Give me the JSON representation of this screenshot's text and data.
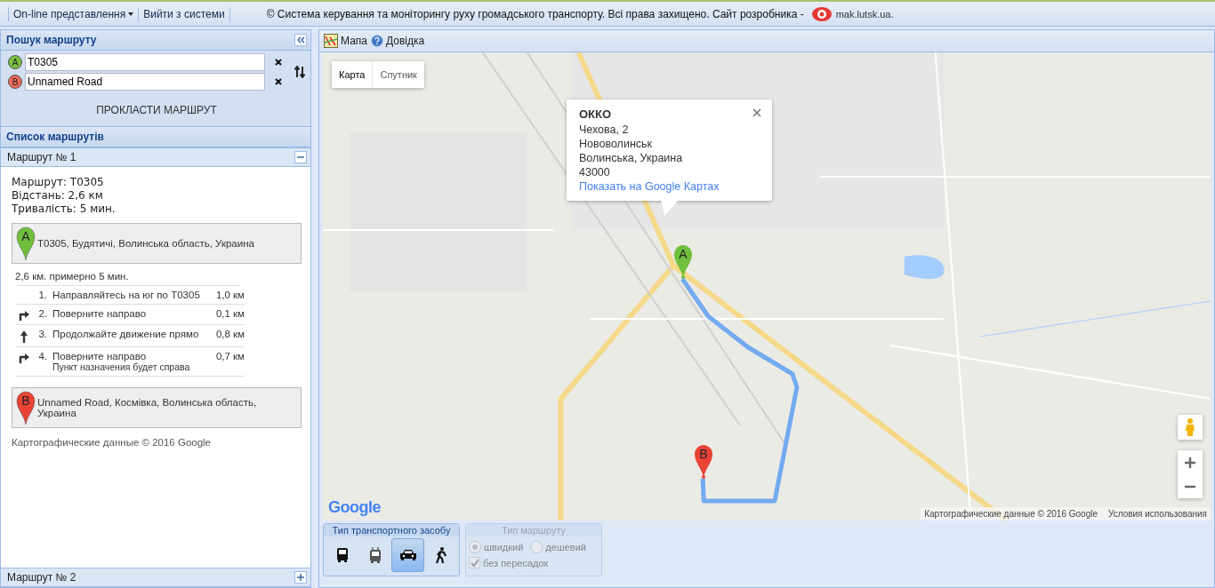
{
  "top_bar": {
    "menu": [
      {
        "label": "On-line представлення",
        "dropdown": true
      },
      {
        "label": "Вийти з системи",
        "dropdown": false
      }
    ],
    "copyright": "© Система керування та моніторингу руху громадського транспорту. Всі права захищено. Сайт розробника -",
    "developer_link": "mak.lutsk.ua."
  },
  "route_search": {
    "title": "Пошук маршруту",
    "from": {
      "letter": "A",
      "value": "T0305"
    },
    "to": {
      "letter": "B",
      "value": "Unnamed Road"
    },
    "build_button": "ПРОКЛАСТИ МАРШРУТ"
  },
  "route_list": {
    "title": "Список маршрутів",
    "routes": [
      {
        "title": "Маршрут № 1",
        "expanded": true,
        "details": {
          "summary": [
            "Маршрут: T0305",
            "Відстань: 2,6 км",
            "Тривалість: 5 мин."
          ],
          "start": {
            "letter": "A",
            "address": "T0305, Будятичі, Волинська область, Украина"
          },
          "overview": "2,6 км. примерно 5 мин.",
          "steps": [
            {
              "kind": "none",
              "number": "1.",
              "instruction": "Направляйтесь на юг по T0305",
              "distance": "1,0 км"
            },
            {
              "kind": "right",
              "number": "2.",
              "instruction": "Поверните направо",
              "distance": "0,1 км"
            },
            {
              "kind": "straight",
              "number": "3.",
              "instruction": "Продолжайте движение прямо",
              "distance": "0,8 км"
            },
            {
              "kind": "right",
              "number": "4.",
              "instruction": "Поверните направо",
              "note": "Пункт назначения будет справа",
              "distance": "0,7 км"
            }
          ],
          "end": {
            "letter": "B",
            "address": "Unnamed Road, Космівка, Волинська область, Украина"
          },
          "copyright": "Картографические данные © 2016 Google"
        }
      },
      {
        "title": "Маршрут № 2",
        "expanded": false
      }
    ]
  },
  "map_toolbar": [
    {
      "label": "Мапа"
    },
    {
      "label": "Довідка"
    }
  ],
  "map": {
    "map_type": [
      {
        "label": "Карта",
        "selected": true
      },
      {
        "label": "Спутник",
        "selected": false
      }
    ],
    "info_window": {
      "title": "ОККО",
      "lines": [
        "Чехова, 2",
        "Нововолинськ",
        "Волинська, Украина",
        "43000"
      ],
      "link": "Показать на Google Картах"
    },
    "markers": [
      {
        "letter": "A",
        "color": "#6fbf3d"
      },
      {
        "letter": "B",
        "color": "#ea4335"
      }
    ],
    "logo": "Google",
    "attribution": "Картографические данные © 2016 Google",
    "terms": "Условия использования"
  },
  "transport_type": {
    "title": "Тип транспортного засобу",
    "modes": [
      {
        "kind": "bus",
        "selected": false
      },
      {
        "kind": "trolleybus",
        "selected": false
      },
      {
        "kind": "car",
        "selected": true
      },
      {
        "kind": "walk",
        "selected": false
      }
    ]
  },
  "route_type": {
    "title": "Тип маршруту",
    "disabled": true,
    "options": [
      {
        "label": "швидкий",
        "selected": true
      },
      {
        "label": "дешевий",
        "selected": false
      }
    ],
    "no_transfers": {
      "label": "без пересадок",
      "checked": true
    }
  }
}
